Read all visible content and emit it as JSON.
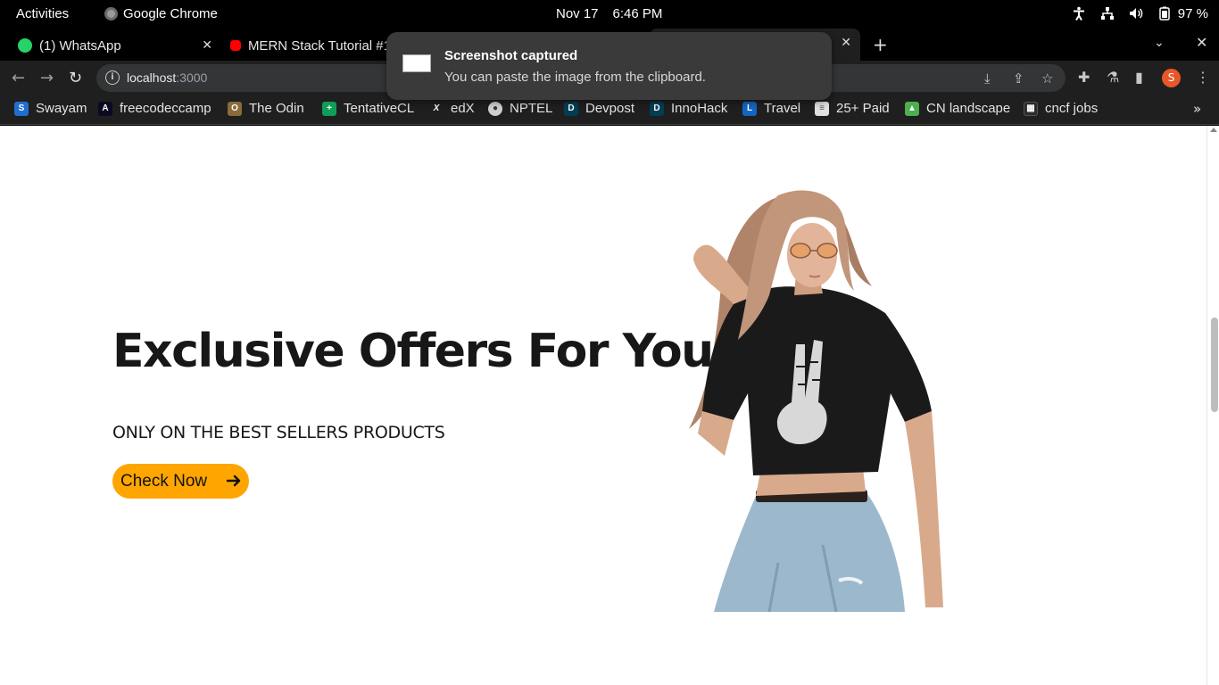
{
  "system_bar": {
    "activities": "Activities",
    "app_name": "Google Chrome",
    "date": "Nov 17",
    "time": "6:46 PM",
    "battery": "97 %"
  },
  "tabs": [
    {
      "label": "(1) WhatsApp",
      "icon": "whatsapp-icon"
    },
    {
      "label": "MERN Stack Tutorial #1",
      "icon": "youtube-icon"
    }
  ],
  "toolbar": {
    "url_host": "localhost",
    "url_port": ":3000"
  },
  "bookmarks": [
    {
      "label": "Swayam"
    },
    {
      "label": "freecodeccamp"
    },
    {
      "label": "The Odin"
    },
    {
      "label": "TentativeCL"
    },
    {
      "label": "edX"
    },
    {
      "label": "NPTEL"
    },
    {
      "label": "Devpost"
    },
    {
      "label": "InnoHack"
    },
    {
      "label": "Travel"
    },
    {
      "label": "25+ Paid"
    },
    {
      "label": "CN landscape"
    },
    {
      "label": "cncf jobs"
    }
  ],
  "profile_initial": "S",
  "notification": {
    "title": "Screenshot captured",
    "body": "You can paste the image from the clipboard."
  },
  "hero": {
    "title": "Exclusive Offers For You",
    "subtitle": "ONLY ON THE BEST SELLERS PRODUCTS",
    "button": "Check Now"
  },
  "colors": {
    "accent": "#ffa500",
    "text": "#171717"
  }
}
